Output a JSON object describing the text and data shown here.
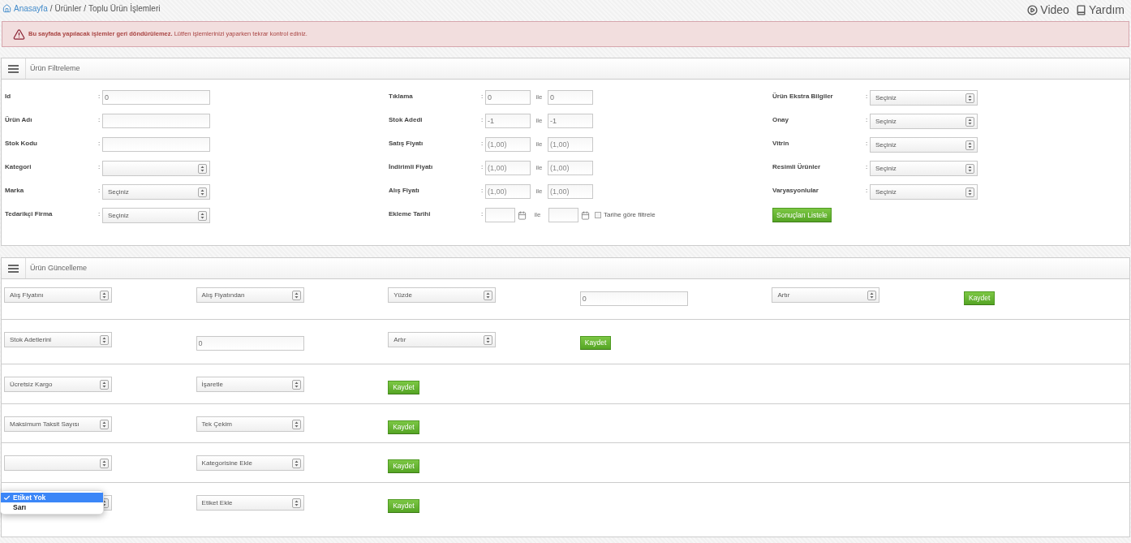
{
  "breadcrumb": {
    "home": "Anasayfa",
    "separator": "/",
    "items": [
      "Ürünler",
      "Toplu Ürün İşlemleri"
    ]
  },
  "header_links": [
    {
      "kind": "video",
      "label": "Video"
    },
    {
      "kind": "help",
      "label": "Yardım"
    }
  ],
  "alert": {
    "text": "**Bu sayfada yapılacak işlemler geri döndürülemez.** Lütfen işlemlerinizi yaparken tekrar kontrol ediniz."
  },
  "filter_panel": {
    "title": "Ürün Filtreleme",
    "columns": [
      [
        {
          "kind": "input",
          "label": "Id",
          "colon": ":",
          "value": "0"
        },
        {
          "kind": "input",
          "label": "Ürün Adı",
          "colon": ":"
        },
        {
          "kind": "input",
          "label": "Stok Kodu",
          "colon": ":"
        },
        {
          "kind": "select",
          "label": "Kategori",
          "colon": ":"
        },
        {
          "kind": "select",
          "label": "Marka",
          "colon": ":",
          "value": "Seçiniz"
        },
        {
          "kind": "select",
          "label": "Tedarikçi Firma",
          "colon": ":",
          "value": "Seçiniz"
        }
      ],
      [
        {
          "kind": "range",
          "label": "Tıklama",
          "colon": ":",
          "from_value": "0",
          "joiner": "ile",
          "to_value": "0"
        },
        {
          "kind": "range",
          "label": "Stok Adedi",
          "colon": ":",
          "from_value": "-1",
          "joiner": "ile",
          "to_value": "-1"
        },
        {
          "kind": "range",
          "label": "Satış Fiyatı",
          "colon": ":",
          "from_placeholder": "(1,00)",
          "joiner": "ile",
          "to_placeholder": "(1,00)"
        },
        {
          "kind": "range",
          "label": "İndirimli Fiyatı",
          "colon": ":",
          "from_placeholder": "(1,00)",
          "joiner": "ile",
          "to_placeholder": "(1,00)"
        },
        {
          "kind": "range",
          "label": "Alış Fiyatı",
          "colon": ":",
          "from_placeholder": "(1,00)",
          "joiner": "ile",
          "to_placeholder": "(1,00)"
        },
        {
          "kind": "date_range",
          "label": "Ekleme Tarihi",
          "colon": ":",
          "joiner": "ile",
          "checkbox": {
            "label": "Tarihe göre filtrele",
            "checked": false
          }
        }
      ],
      [
        {
          "kind": "select",
          "label": "Ürün Ekstra Bilgiler",
          "colon": ":",
          "value": "Seçiniz"
        },
        {
          "kind": "select",
          "label": "Onay",
          "colon": ":",
          "value": "Seçiniz"
        },
        {
          "kind": "select",
          "label": "Vitrin",
          "colon": ":",
          "value": "Seçiniz"
        },
        {
          "kind": "select",
          "label": "Resimli Ürünler",
          "colon": ":",
          "value": "Seçiniz"
        },
        {
          "kind": "select",
          "label": "Varyasyonlular",
          "colon": ":",
          "value": "Seçiniz"
        },
        {
          "kind": "button",
          "label": "Sonuçları Listele"
        }
      ]
    ]
  },
  "update_panel": {
    "title": "Ürün Güncelleme",
    "rows": [
      {
        "controls": [
          {
            "kind": "select",
            "value": "Alış Fiyatını"
          },
          {
            "kind": "select",
            "value": "Alış Fiyatından"
          },
          {
            "kind": "select",
            "value": "Yüzde"
          },
          {
            "kind": "input",
            "value": "0"
          },
          {
            "kind": "select",
            "value": "Artır"
          },
          {
            "kind": "button",
            "label": "Kaydet"
          }
        ]
      },
      {
        "controls": [
          {
            "kind": "select",
            "value": "Stok Adetlerini"
          },
          {
            "kind": "input",
            "value": "0"
          },
          {
            "kind": "select",
            "value": "Artır"
          },
          {
            "kind": "button",
            "label": "Kaydet"
          }
        ]
      },
      {
        "controls": [
          {
            "kind": "select",
            "value": "Ücretsiz Kargo"
          },
          {
            "kind": "select",
            "value": "İşaretle"
          },
          {
            "kind": "button",
            "label": "Kaydet"
          }
        ]
      },
      {
        "controls": [
          {
            "kind": "select",
            "value": "Maksimum Taksit Sayısı"
          },
          {
            "kind": "select",
            "value": "Tek Çekim"
          },
          {
            "kind": "button",
            "label": "Kaydet"
          }
        ]
      },
      {
        "controls": [
          {
            "kind": "select"
          },
          {
            "kind": "select",
            "value": "Kategorisine Ekle"
          },
          {
            "kind": "button",
            "label": "Kaydet"
          }
        ]
      },
      {
        "controls": [
          {
            "kind": "select",
            "open": true,
            "options": [
              {
                "label": "Etiket Yok",
                "selected": true
              },
              {
                "label": "Sarı",
                "selected": false
              }
            ]
          },
          {
            "kind": "select",
            "value": "Etiket Ekle"
          },
          {
            "kind": "button",
            "label": "Kaydet"
          }
        ]
      }
    ]
  }
}
